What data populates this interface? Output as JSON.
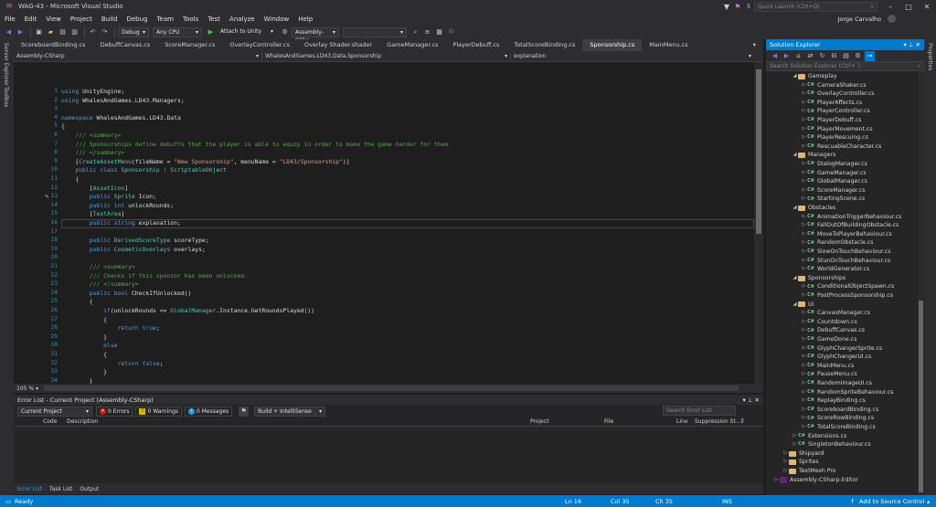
{
  "window": {
    "title": "WAG-43 - Microsoft Visual Studio",
    "quick_launch_placeholder": "Quick Launch (Ctrl+Q)",
    "notification_count": "5",
    "user": "Jorge Carvalho"
  },
  "menu": [
    "File",
    "Edit",
    "View",
    "Project",
    "Build",
    "Debug",
    "Team",
    "Tools",
    "Test",
    "Analyze",
    "Window",
    "Help"
  ],
  "toolbar": {
    "config": "Debug",
    "platform": "Any CPU",
    "attach": "Attach to Unity",
    "assembly": "Assembly-CSha"
  },
  "side_rail": {
    "left": [
      "Server Explorer",
      "Toolbox"
    ],
    "right": [
      "Properties"
    ]
  },
  "doc_tabs": [
    "ScoreboardBinding.cs",
    "DebuffCanvas.cs",
    "ScoreManager.cs",
    "OverlayController.cs",
    "Overlay Shader.shader",
    "GameManager.cs",
    "PlayerDebuff.cs",
    "TotalScoreBinding.cs",
    "Sponsorship.cs",
    "MainMenu.cs"
  ],
  "active_tab": "Sponsorship.cs",
  "navbar": {
    "project": "Assembly-CSharp",
    "class": "WhalesAndGames.LD43.Data.Sponsorship",
    "member": "explanation"
  },
  "editor": {
    "zoom": "105 %",
    "current_line": 16,
    "lines": [
      [
        [
          "kw",
          "using"
        ],
        [
          "pl",
          " UnityEngine;"
        ]
      ],
      [
        [
          "kw",
          "using"
        ],
        [
          "pl",
          " WhalesAndGames.LD43.Managers;"
        ]
      ],
      [],
      [
        [
          "kw",
          "namespace"
        ],
        [
          "pl",
          " WhalesAndGames.LD43.Data"
        ]
      ],
      [
        [
          "pl",
          "{"
        ]
      ],
      [
        [
          "pl",
          "    "
        ],
        [
          "cm",
          "/// <summary>"
        ]
      ],
      [
        [
          "pl",
          "    "
        ],
        [
          "cm",
          "/// Sponsorships define debuffs that the player is able to equip in order to make the game harder for them."
        ]
      ],
      [
        [
          "pl",
          "    "
        ],
        [
          "cm",
          "/// </summary>"
        ]
      ],
      [
        [
          "pl",
          "    ["
        ],
        [
          "at",
          "CreateAssetMenu"
        ],
        [
          "pl",
          "(fileName = "
        ],
        [
          "st",
          "\"New Sponsorship\""
        ],
        [
          "pl",
          ", menuName = "
        ],
        [
          "st",
          "\"LD43/Sponsorship\""
        ],
        [
          "pl",
          ")]"
        ]
      ],
      [
        [
          "pl",
          "    "
        ],
        [
          "kw",
          "public class"
        ],
        [
          "pl",
          " "
        ],
        [
          "ty",
          "Sponsorship"
        ],
        [
          "pl",
          " : "
        ],
        [
          "ty",
          "ScriptableObject"
        ]
      ],
      [
        [
          "pl",
          "    {"
        ]
      ],
      [
        [
          "pl",
          "        ["
        ],
        [
          "at",
          "AssetIcon"
        ],
        [
          "pl",
          "]"
        ]
      ],
      [
        [
          "pl",
          "        "
        ],
        [
          "kw",
          "public"
        ],
        [
          "pl",
          " "
        ],
        [
          "ty",
          "Sprite"
        ],
        [
          "pl",
          " Icon;"
        ]
      ],
      [
        [
          "pl",
          "        "
        ],
        [
          "kw",
          "public int"
        ],
        [
          "pl",
          " unlockRounds;"
        ]
      ],
      [
        [
          "pl",
          "        ["
        ],
        [
          "at",
          "TextArea"
        ],
        [
          "pl",
          "]"
        ]
      ],
      [
        [
          "pl",
          "        "
        ],
        [
          "kw",
          "public string"
        ],
        [
          "pl",
          " explanation;"
        ]
      ],
      [],
      [
        [
          "pl",
          "        "
        ],
        [
          "kw",
          "public"
        ],
        [
          "pl",
          " "
        ],
        [
          "ty",
          "DerivedScoreType"
        ],
        [
          "pl",
          " scoreType;"
        ]
      ],
      [
        [
          "pl",
          "        "
        ],
        [
          "kw",
          "public"
        ],
        [
          "pl",
          " "
        ],
        [
          "ty",
          "CosmeticOverlays"
        ],
        [
          "pl",
          " overlays;"
        ]
      ],
      [],
      [
        [
          "pl",
          "        "
        ],
        [
          "cm",
          "/// <summary>"
        ]
      ],
      [
        [
          "pl",
          "        "
        ],
        [
          "cm",
          "/// Checks if this sponsor has been unlocked."
        ]
      ],
      [
        [
          "pl",
          "        "
        ],
        [
          "cm",
          "/// </summary>"
        ]
      ],
      [
        [
          "pl",
          "        "
        ],
        [
          "kw",
          "public bool"
        ],
        [
          "pl",
          " CheckIfUnlocked()"
        ]
      ],
      [
        [
          "pl",
          "        {"
        ]
      ],
      [
        [
          "pl",
          "            "
        ],
        [
          "kw",
          "if"
        ],
        [
          "pl",
          "(unlockRounds <= "
        ],
        [
          "ty",
          "GlobalManager"
        ],
        [
          "pl",
          ".Instance.GetRoundsPlayed())"
        ]
      ],
      [
        [
          "pl",
          "            {"
        ]
      ],
      [
        [
          "pl",
          "                "
        ],
        [
          "kw",
          "return true"
        ],
        [
          "pl",
          ";"
        ]
      ],
      [
        [
          "pl",
          "            }"
        ]
      ],
      [
        [
          "pl",
          "            "
        ],
        [
          "kw",
          "else"
        ]
      ],
      [
        [
          "pl",
          "            {"
        ]
      ],
      [
        [
          "pl",
          "                "
        ],
        [
          "kw",
          "return false"
        ],
        [
          "pl",
          ";"
        ]
      ],
      [
        [
          "pl",
          "            }"
        ]
      ],
      [
        [
          "pl",
          "        }"
        ]
      ],
      [
        [
          "pl",
          "    }"
        ]
      ],
      [
        [
          "pl",
          "}"
        ]
      ]
    ]
  },
  "error_list": {
    "title": "Error List - Current Project (Assembly-CSharp)",
    "scope": "Current Project",
    "errors": "0 Errors",
    "warnings": "0 Warnings",
    "messages": "0 Messages",
    "build_filter": "Build + IntelliSense",
    "search_placeholder": "Search Error List",
    "columns": [
      "Code",
      "Description",
      "Project",
      "File",
      "Line",
      "Suppression St..."
    ]
  },
  "bottom_tabs": [
    "Error List",
    "Task List",
    "Output"
  ],
  "solution_explorer": {
    "title": "Solution Explorer",
    "search_placeholder": "Search Solution Explorer (Ctrl+`)",
    "tree": [
      [
        "folder",
        "Gameplay",
        2,
        "open"
      ],
      [
        "cs",
        "CameraShaker.cs",
        3
      ],
      [
        "cs",
        "OverlayController.cs",
        3
      ],
      [
        "cs",
        "PlayerAffects.cs",
        3
      ],
      [
        "cs",
        "PlayerController.cs",
        3
      ],
      [
        "cs",
        "PlayerDebuff.cs",
        3
      ],
      [
        "cs",
        "PlayerMovement.cs",
        3
      ],
      [
        "cs",
        "PlayerRescuing.cs",
        3
      ],
      [
        "cs",
        "RescuableCharacter.cs",
        3
      ],
      [
        "folder",
        "Managers",
        2,
        "open"
      ],
      [
        "cs",
        "DialogManager.cs",
        3
      ],
      [
        "cs",
        "GameManager.cs",
        3
      ],
      [
        "cs",
        "GlobalManager.cs",
        3
      ],
      [
        "cs",
        "ScoreManager.cs",
        3
      ],
      [
        "cs",
        "StartingScene.cs",
        3
      ],
      [
        "folder",
        "Obstacles",
        2,
        "open"
      ],
      [
        "cs",
        "AnimationTriggerBehaviour.cs",
        3
      ],
      [
        "cs",
        "FallOutOfBuildingObstacle.cs",
        3
      ],
      [
        "cs",
        "MoveToPlayerBehaviour.cs",
        3
      ],
      [
        "cs",
        "RandomObstacle.cs",
        3
      ],
      [
        "cs",
        "SlowOnTouchBehaviour.cs",
        3
      ],
      [
        "cs",
        "StunOnTouchBehaviour.cs",
        3
      ],
      [
        "cs",
        "WorldGenerator.cs",
        3
      ],
      [
        "folder",
        "Sponsorships",
        2,
        "open"
      ],
      [
        "cs",
        "ConditionalObjectSpawn.cs",
        3
      ],
      [
        "cs",
        "PostProcessSponsorship.cs",
        3
      ],
      [
        "folder",
        "UI",
        2,
        "open"
      ],
      [
        "cs",
        "CanvasManager.cs",
        3
      ],
      [
        "cs",
        "Countdown.cs",
        3
      ],
      [
        "cs",
        "DebuffCanvas.cs",
        3
      ],
      [
        "cs",
        "GameDone.cs",
        3
      ],
      [
        "cs",
        "GlyphChangerSprite.cs",
        3
      ],
      [
        "cs",
        "GlyphChangerUI.cs",
        3
      ],
      [
        "cs",
        "MainMenu.cs",
        3
      ],
      [
        "cs",
        "PauseMenu.cs",
        3
      ],
      [
        "cs",
        "RandomImageUI.cs",
        3
      ],
      [
        "cs",
        "RandomSpriteBehaviour.cs",
        3
      ],
      [
        "cs",
        "ReplayBinding.cs",
        3
      ],
      [
        "cs",
        "ScoreboardBinding.cs",
        3
      ],
      [
        "cs",
        "ScoreRowBinding.cs",
        3
      ],
      [
        "cs",
        "TotalScoreBinding.cs",
        3
      ],
      [
        "cs",
        "Extensions.cs",
        2
      ],
      [
        "cs",
        "SingletonBehaviour.cs",
        2
      ],
      [
        "folder",
        "Shipyard",
        1,
        "closed"
      ],
      [
        "folder",
        "Sprites",
        1,
        "closed"
      ],
      [
        "folder",
        "TextMesh Pro",
        1,
        "closed"
      ],
      [
        "proj",
        "Assembly-CSharp-Editor",
        0,
        "closed"
      ]
    ]
  },
  "status_bar": {
    "state": "Ready",
    "line": "Ln 16",
    "col": "Col 35",
    "ch": "Ch 35",
    "ins": "INS",
    "source_control": "Add to Source Control"
  },
  "colors": {
    "accent": "#007acc",
    "keyword": "#569cd6",
    "type": "#4ec9b0",
    "string": "#d69d85",
    "comment": "#57a64a"
  }
}
